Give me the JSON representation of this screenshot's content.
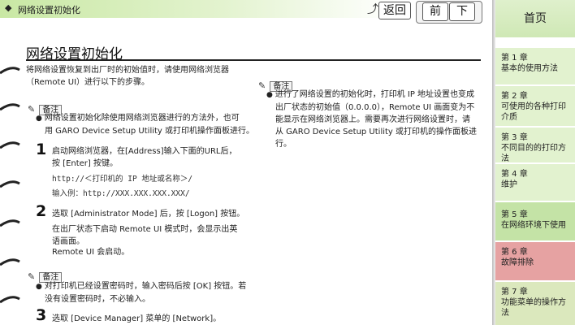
{
  "header": {
    "breadcrumb": "网络设置初始化",
    "back_label": "返回",
    "prev_label": "前",
    "next_label": "下"
  },
  "page": {
    "title": "网络设置初始化",
    "intro_1": "将网络设置恢复到出厂时的初始值时，请使用网络浏览器",
    "intro_2": "（Remote UI）进行以下的步骤。"
  },
  "note_label": "备注",
  "note1": {
    "line1": "网络设置初始化除使用网络浏览器进行的方法外，也可",
    "line2": "用 GARO Device Setup Utility 或打印机操作面板进行。"
  },
  "steps": [
    {
      "num": "1",
      "line1": "启动网络浏览器，在[Address]输入下面的URL后，",
      "line2": "按 [Enter] 按键。",
      "url_line": "http://＜打印机的 IP 地址或名称＞/",
      "example": "输入例：http://XXX.XXX.XXX.XXX/"
    },
    {
      "num": "2",
      "line1": "选取 [Administrator Mode] 后，按 [Logon] 按钮。",
      "sub1": "在出厂状态下启动 Remote UI 模式时，会显示出英",
      "sub2": "语画面。",
      "sub3": "Remote UI 会启动。"
    },
    {
      "num": "3",
      "line1": "选取 [Device Manager] 菜单的 [Network]。"
    }
  ],
  "note2": {
    "line1": "对打印机已经设置密码时，输入密码后按 [OK] 按钮。若",
    "line2": "没有设置密码时，不必输入。"
  },
  "note3": {
    "line1": "进行了网络设置的初始化时，打印机 IP 地址设置也变成",
    "line2": "出厂状态的初始值（0.0.0.0），Remote UI 画面变为不",
    "line3": "能显示在网络浏览器上。需要再次进行网络设置时，请",
    "line4": "从 GARO Device Setup Utility 或打印机的操作面板进",
    "line5": "行。"
  },
  "sidebar": {
    "home": "首页",
    "items": [
      {
        "chapter": "第 1 章",
        "title": "基本的使用方法"
      },
      {
        "chapter": "第 2 章",
        "title": "可使用的各种打印",
        "title2": "介质"
      },
      {
        "chapter": "第 3 章",
        "title": "不同目的的打印方",
        "title2": "法"
      },
      {
        "chapter": "第 4 章",
        "title": "维护"
      },
      {
        "chapter": "第 5 章",
        "title": "在网络环境下使用"
      },
      {
        "chapter": "第 6 章",
        "title": "故障排除"
      },
      {
        "chapter": "第 7 章",
        "title": "功能菜单的操作方",
        "title2": "法"
      }
    ]
  },
  "colors": {
    "topbar": "#c9e8a4",
    "sidebar_green": "#e2f2cf",
    "sidebar_pink": "#e6a2a2"
  }
}
